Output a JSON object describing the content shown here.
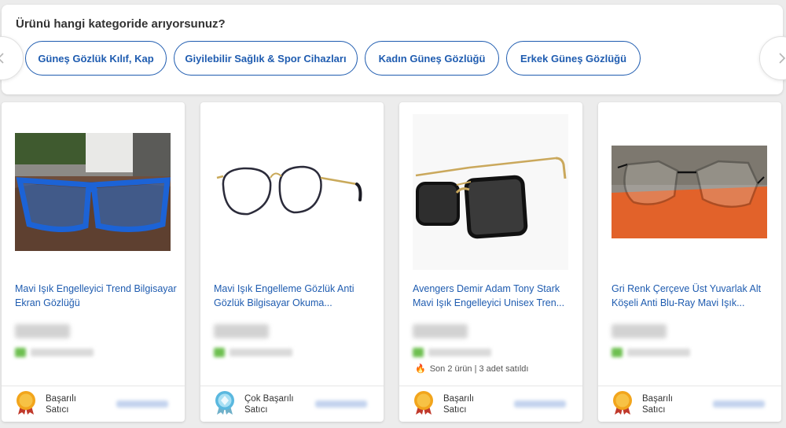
{
  "category_panel": {
    "title": "Ürünü hangi kategoride arıyorsunuz?",
    "chips": [
      {
        "label": "Güneş Gözlük Kılıf, Kap"
      },
      {
        "label": "Giyilebilir Sağlık & Spor Cihazları"
      },
      {
        "label": "Kadın Güneş Gözlüğü"
      },
      {
        "label": "Erkek Güneş Gözlüğü"
      }
    ],
    "prev_icon": "chevron-left-icon",
    "next_icon": "chevron-right-icon"
  },
  "products": [
    {
      "name": "Mavi Işık Engelleyici Trend Bilgisayar Ekran Gözlüğü",
      "image": "blue-frame-glasses-photo",
      "seller_badge": "gold-medal-icon",
      "seller_label_1": "Başarılı",
      "seller_label_2": "Satıcı",
      "stock_note": ""
    },
    {
      "name": "Mavi Işık Engelleme Gözlük Anti Gözlük Bilgisayar Okuma...",
      "image": "round-metal-glasses-photo",
      "seller_badge": "diamond-medal-icon",
      "seller_label_1": "Çok Başarılı",
      "seller_label_2": "Satıcı",
      "stock_note": ""
    },
    {
      "name": "Avengers Demir Adam Tony Stark Mavi Işık Engelleyici Unisex Tren...",
      "image": "square-sunglasses-photo",
      "seller_badge": "gold-medal-icon",
      "seller_label_1": "Başarılı",
      "seller_label_2": "Satıcı",
      "stock_note": "Son 2 ürün | 3 adet satıldı"
    },
    {
      "name": "Gri Renk Çerçeve Üst Yuvarlak Alt Köşeli Anti Blu-Ray Mavi Işık...",
      "image": "geometric-glasses-photo",
      "seller_badge": "gold-medal-icon",
      "seller_label_1": "Başarılı",
      "seller_label_2": "Satıcı",
      "stock_note": ""
    }
  ],
  "colors": {
    "accent": "#1f5cb0",
    "gold_medal": "#f2a51c",
    "diamond_medal": "#5ab8df",
    "ribbon": "#c0392b",
    "flame": "#e22828"
  }
}
